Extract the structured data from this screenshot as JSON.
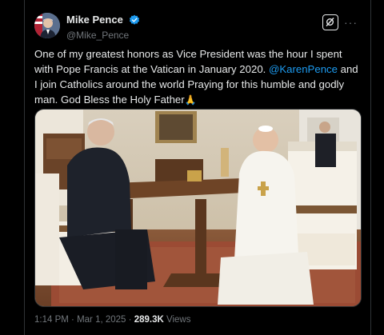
{
  "post": {
    "author": {
      "display_name": "Mike Pence",
      "handle": "@Mike_Pence",
      "verified": true
    },
    "text_before": "One of my greatest honors as Vice President was the hour I spent with Pope Francis at the Vatican in January 2020. ",
    "mention": "@KarenPence",
    "text_after": " and I join Catholics around the world Praying  for this humble and godly man. God Bless the Holy Father",
    "emoji": "🙏",
    "time": "1:14 PM",
    "date": "Mar 1, 2025",
    "views_count": "289.3K",
    "views_label": "Views",
    "separator": "·"
  },
  "icons": {
    "verified": "verified-badge-icon",
    "grok": "grok-icon",
    "more": "more-options-icon"
  },
  "colors": {
    "background": "#000000",
    "text": "#e7e9ea",
    "secondary": "#71767b",
    "accent": "#1d9bf0"
  }
}
